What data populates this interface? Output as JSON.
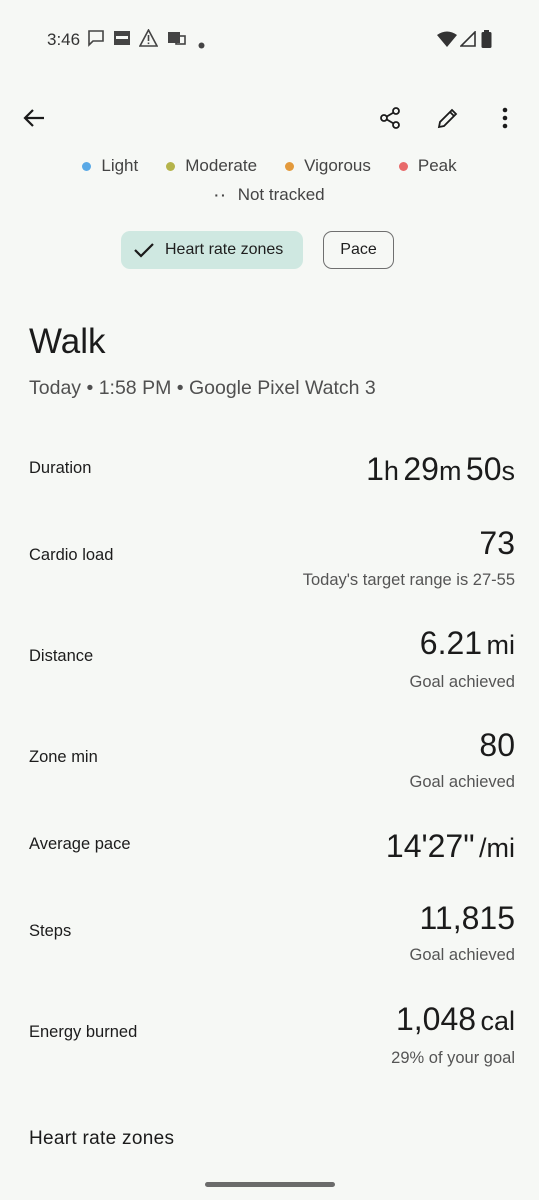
{
  "status_bar": {
    "time": "3:46"
  },
  "legend": {
    "items": [
      {
        "label": "Light",
        "color": "#5aa9e6"
      },
      {
        "label": "Moderate",
        "color": "#b5b44b"
      },
      {
        "label": "Vigorous",
        "color": "#e39a3c"
      },
      {
        "label": "Peak",
        "color": "#e86a6a"
      }
    ],
    "not_tracked_symbol": "··",
    "not_tracked_label": "Not tracked"
  },
  "chips": {
    "heart_rate_zones": "Heart rate zones",
    "pace": "Pace"
  },
  "activity": {
    "title": "Walk",
    "subtitle": "Today • 1:58 PM • Google Pixel Watch 3"
  },
  "metrics": {
    "duration": {
      "label": "Duration",
      "h": "1",
      "h_unit": "h",
      "m": "29",
      "m_unit": "m",
      "s": "50",
      "s_unit": "s"
    },
    "cardio_load": {
      "label": "Cardio load",
      "value": "73",
      "sub": "Today's target range is 27-55"
    },
    "distance": {
      "label": "Distance",
      "value": "6.21",
      "unit": "mi",
      "sub": "Goal achieved"
    },
    "zone_min": {
      "label": "Zone min",
      "value": "80",
      "sub": "Goal achieved"
    },
    "average_pace": {
      "label": "Average pace",
      "value": "14'27\"",
      "unit": "/mi"
    },
    "steps": {
      "label": "Steps",
      "value": "11,815",
      "sub": "Goal achieved"
    },
    "energy": {
      "label": "Energy burned",
      "value": "1,048",
      "unit": "cal",
      "sub": "29% of your goal"
    }
  },
  "sections": {
    "heart_rate_zones": "Heart rate zones"
  }
}
